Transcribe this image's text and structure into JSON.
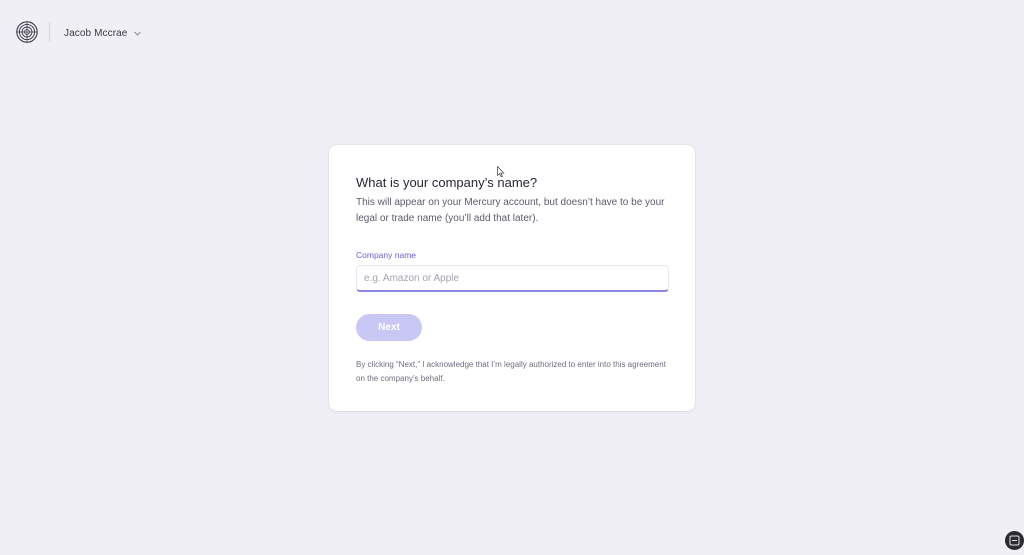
{
  "header": {
    "logo_icon": "mercury-logo-icon",
    "user_name": "Jacob Mccrae",
    "user_menu_icon": "chevron-down-icon"
  },
  "form": {
    "title": "What is your company’s name?",
    "description": "This will appear on your Mercury account, but doesn’t have to be your legal or trade name (you’ll add that later).",
    "company_name_label": "Company name",
    "company_name_value": "",
    "company_name_placeholder": "e.g. Amazon or Apple",
    "next_label": "Next",
    "legal_text": "By clicking “Next,” I acknowledge that I’m legally authorized to enter into this agreement on the company’s behalf."
  },
  "colors": {
    "background": "#f1eff6",
    "accent": "#6a5fd0",
    "button_disabled": "#c9c7f4",
    "input_focus_border": "#8b85e8"
  },
  "overlay": {
    "corner_icon": "screen-capture-icon"
  }
}
